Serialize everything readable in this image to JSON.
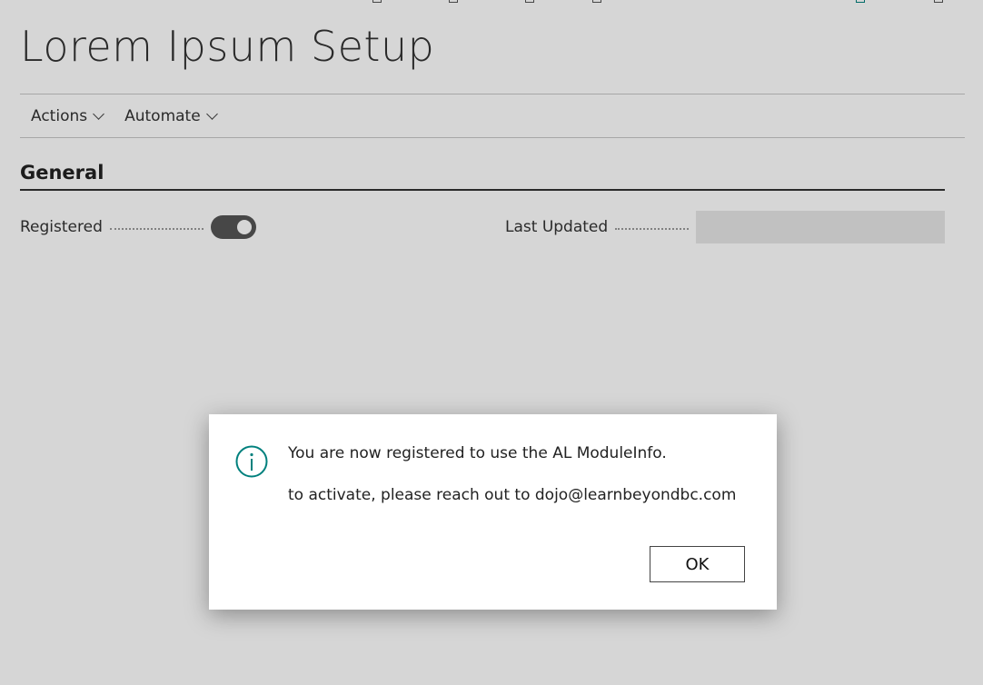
{
  "page": {
    "title": "Lorem Ipsum Setup"
  },
  "actionbar": {
    "menus": [
      {
        "label": "Actions"
      },
      {
        "label": "Automate"
      }
    ]
  },
  "general": {
    "section_title": "General",
    "registered": {
      "label": "Registered",
      "value": true
    },
    "last_updated": {
      "label": "Last Updated",
      "value": ""
    }
  },
  "dialog": {
    "icon": "info-icon",
    "line1": "You are now registered to use the AL ModuleInfo.",
    "line2": "to activate, please reach out to dojo@learnbeyondbc.com",
    "ok_label": "OK"
  },
  "colors": {
    "accent": "#00807d",
    "overlay": "#d6d6d6"
  }
}
